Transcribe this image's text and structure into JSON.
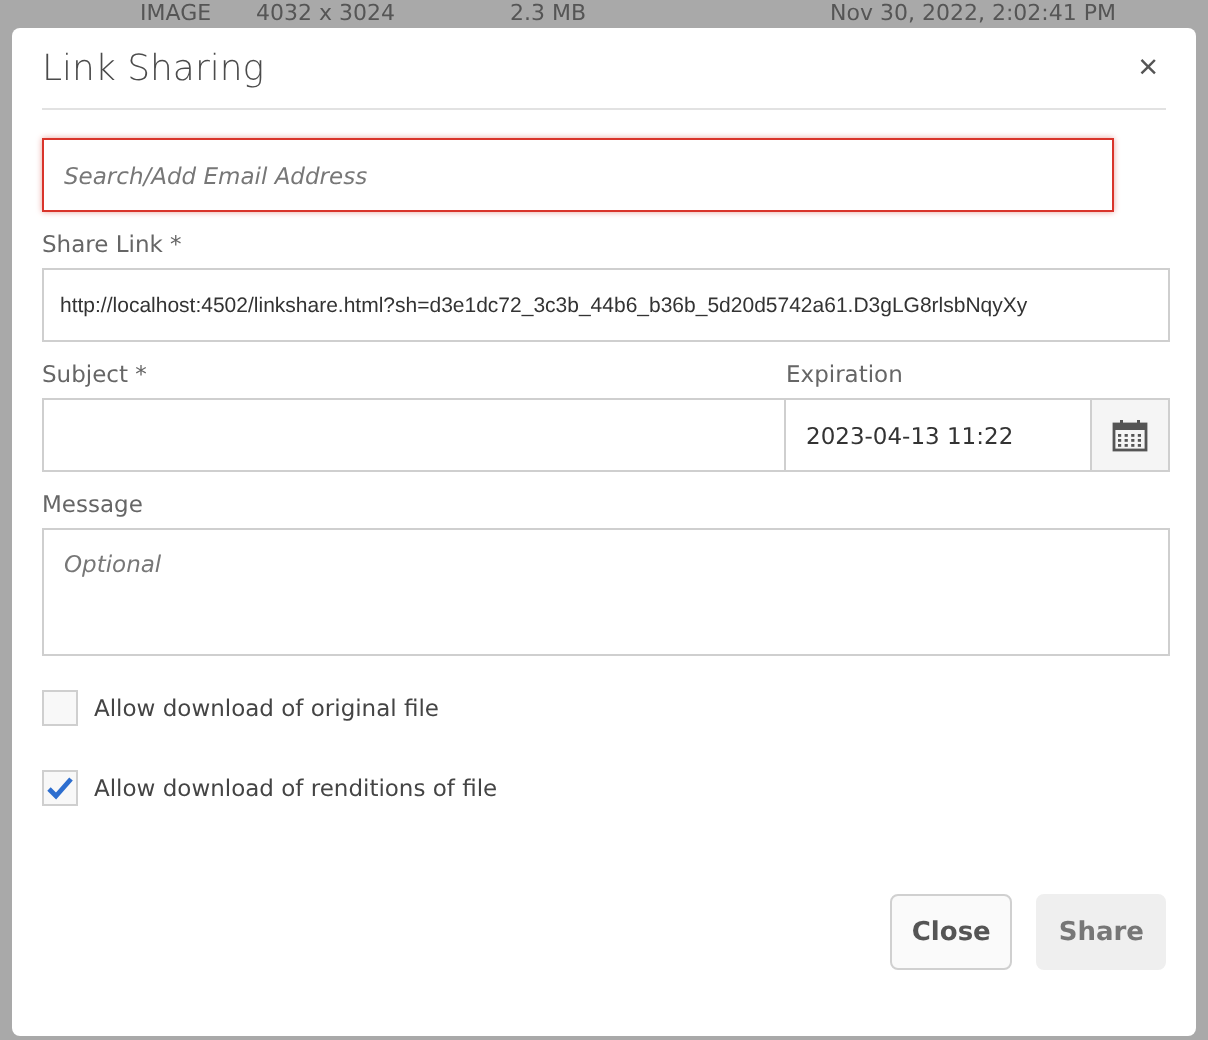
{
  "background_row": [
    "IMAGE",
    "4032 x 3024",
    "2.3 MB",
    "Nov 30, 2022, 2:02:41 PM"
  ],
  "dialog": {
    "title": "Link Sharing",
    "close_icon": "×",
    "email_field": {
      "placeholder": "Search/Add Email Address",
      "focused": true
    },
    "share_link": {
      "label": "Share Link *",
      "value": "http://localhost:4502/linkshare.html?sh=d3e1dc72_3c3b_44b6_b36b_5d20d5742a61.D3gLG8rlsbNqyXy"
    },
    "subject": {
      "label": "Subject *"
    },
    "expiration": {
      "label": "Expiration",
      "value": "2023-04-13 11:22"
    },
    "message": {
      "label": "Message",
      "placeholder": "Optional"
    },
    "options": [
      {
        "label": "Allow download of original file",
        "checked": false
      },
      {
        "label": "Allow download of renditions of file",
        "checked": true
      }
    ],
    "buttons": [
      {
        "label": "Close",
        "disabled": false
      },
      {
        "label": "Share",
        "disabled": true
      }
    ]
  }
}
